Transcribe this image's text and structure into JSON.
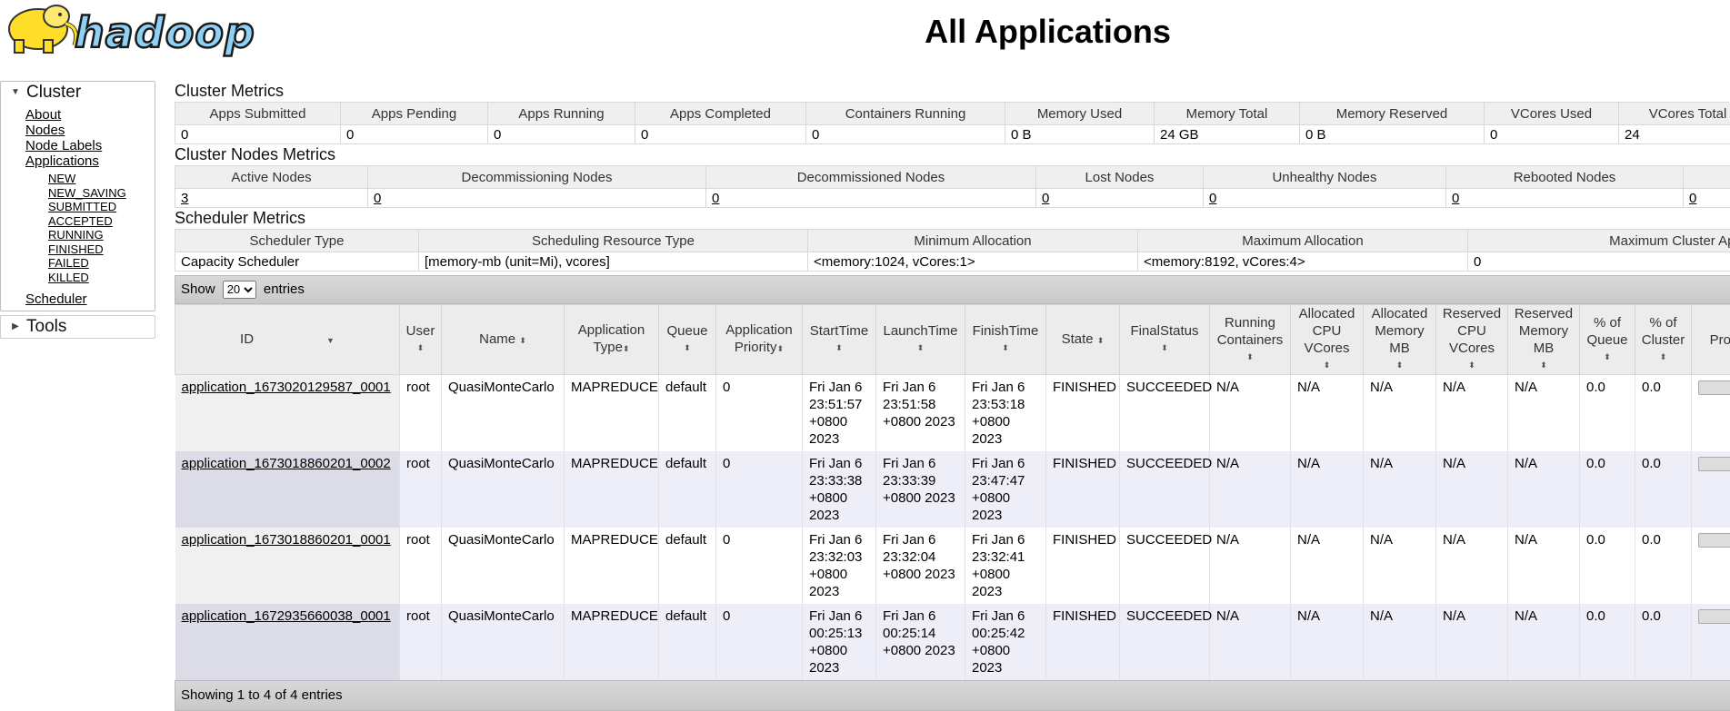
{
  "header": {
    "logo_text": "hadoop",
    "title": "All Applications"
  },
  "sidebar": {
    "cluster_label": "Cluster",
    "links": [
      "About",
      "Nodes",
      "Node Labels",
      "Applications"
    ],
    "app_states": [
      "NEW",
      "NEW_SAVING",
      "SUBMITTED",
      "ACCEPTED",
      "RUNNING",
      "FINISHED",
      "FAILED",
      "KILLED"
    ],
    "scheduler_label": "Scheduler",
    "tools_label": "Tools"
  },
  "cluster_metrics": {
    "title": "Cluster Metrics",
    "headers": [
      "Apps Submitted",
      "Apps Pending",
      "Apps Running",
      "Apps Completed",
      "Containers Running",
      "Memory Used",
      "Memory Total",
      "Memory Reserved",
      "VCores Used",
      "VCores Total"
    ],
    "values": [
      "0",
      "0",
      "0",
      "0",
      "0",
      "0 B",
      "24 GB",
      "0 B",
      "0",
      "24"
    ]
  },
  "nodes_metrics": {
    "title": "Cluster Nodes Metrics",
    "headers": [
      "Active Nodes",
      "Decommissioning Nodes",
      "Decommissioned Nodes",
      "Lost Nodes",
      "Unhealthy Nodes",
      "Rebooted Nodes",
      ""
    ],
    "values": [
      "3",
      "0",
      "0",
      "0",
      "0",
      "0",
      "0"
    ]
  },
  "scheduler_metrics": {
    "title": "Scheduler Metrics",
    "headers": [
      "Scheduler Type",
      "Scheduling Resource Type",
      "Minimum Allocation",
      "Maximum Allocation",
      "Maximum Cluster Applic"
    ],
    "values": [
      "Capacity Scheduler",
      "[memory-mb (unit=Mi), vcores]",
      "<memory:1024, vCores:1>",
      "<memory:8192, vCores:4>",
      "0"
    ]
  },
  "apps_table": {
    "show_label": "Show",
    "entries_label": "entries",
    "page_size": "20",
    "headers": [
      "ID",
      "User",
      "Name",
      "Application Type",
      "Queue",
      "Application Priority",
      "StartTime",
      "LaunchTime",
      "FinishTime",
      "State",
      "FinalStatus",
      "Running Containers",
      "Allocated CPU VCores",
      "Allocated Memory MB",
      "Reserved CPU VCores",
      "Reserved Memory MB",
      "% of Queue",
      "% of Cluster",
      "Prog"
    ],
    "rows": [
      [
        "application_1673020129587_0001",
        "root",
        "QuasiMonteCarlo",
        "MAPREDUCE",
        "default",
        "0",
        "Fri Jan 6 23:51:57 +0800 2023",
        "Fri Jan 6 23:51:58 +0800 2023",
        "Fri Jan 6 23:53:18 +0800 2023",
        "FINISHED",
        "SUCCEEDED",
        "N/A",
        "N/A",
        "N/A",
        "N/A",
        "N/A",
        "0.0",
        "0.0"
      ],
      [
        "application_1673018860201_0002",
        "root",
        "QuasiMonteCarlo",
        "MAPREDUCE",
        "default",
        "0",
        "Fri Jan 6 23:33:38 +0800 2023",
        "Fri Jan 6 23:33:39 +0800 2023",
        "Fri Jan 6 23:47:47 +0800 2023",
        "FINISHED",
        "SUCCEEDED",
        "N/A",
        "N/A",
        "N/A",
        "N/A",
        "N/A",
        "0.0",
        "0.0"
      ],
      [
        "application_1673018860201_0001",
        "root",
        "QuasiMonteCarlo",
        "MAPREDUCE",
        "default",
        "0",
        "Fri Jan 6 23:32:03 +0800 2023",
        "Fri Jan 6 23:32:04 +0800 2023",
        "Fri Jan 6 23:32:41 +0800 2023",
        "FINISHED",
        "SUCCEEDED",
        "N/A",
        "N/A",
        "N/A",
        "N/A",
        "N/A",
        "0.0",
        "0.0"
      ],
      [
        "application_1672935660038_0001",
        "root",
        "QuasiMonteCarlo",
        "MAPREDUCE",
        "default",
        "0",
        "Fri Jan 6 00:25:13 +0800 2023",
        "Fri Jan 6 00:25:14 +0800 2023",
        "Fri Jan 6 00:25:42 +0800 2023",
        "FINISHED",
        "SUCCEEDED",
        "N/A",
        "N/A",
        "N/A",
        "N/A",
        "N/A",
        "0.0",
        "0.0"
      ]
    ],
    "footer": "Showing 1 to 4 of 4 entries"
  }
}
